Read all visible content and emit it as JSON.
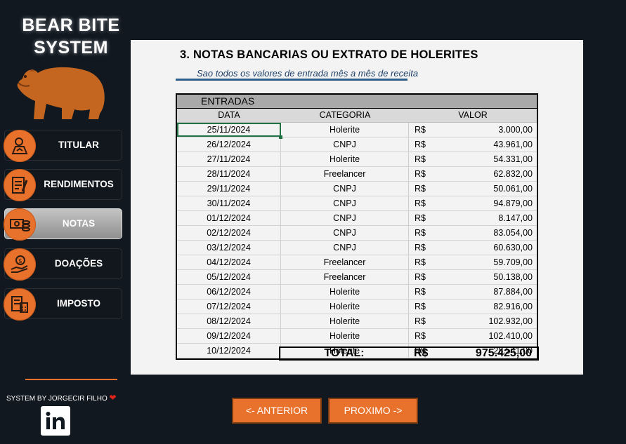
{
  "brand": {
    "line1": "BEAR BITE",
    "line2": "SYSTEM"
  },
  "nav": [
    {
      "label": "TITULAR",
      "icon": "person-document-icon"
    },
    {
      "label": "RENDIMENTOS",
      "icon": "report-pen-icon"
    },
    {
      "label": "NOTAS",
      "icon": "money-coins-icon",
      "active": true
    },
    {
      "label": "DOAÇÕES",
      "icon": "hand-coin-icon"
    },
    {
      "label": "IMPOSTO",
      "icon": "calculator-document-icon"
    }
  ],
  "credits": "SYSTEM BY JORGECIR FILHO",
  "page": {
    "title": "3. NOTAS BANCARIAS OU EXTRATO DE HOLERITES",
    "subtitle": "Sao todos os valores de entrada mês a mês de receita"
  },
  "table": {
    "section": "ENTRADAS",
    "headers": {
      "date": "DATA",
      "category": "CATEGORIA",
      "value": "VALOR"
    },
    "rows": [
      {
        "date": "25/11/2024",
        "category": "Holerite",
        "currency": "R$",
        "value": "3.000,00"
      },
      {
        "date": "26/12/2024",
        "category": "CNPJ",
        "currency": "R$",
        "value": "43.961,00"
      },
      {
        "date": "27/11/2024",
        "category": "Holerite",
        "currency": "R$",
        "value": "54.331,00"
      },
      {
        "date": "28/11/2024",
        "category": "Freelancer",
        "currency": "R$",
        "value": "62.832,00"
      },
      {
        "date": "29/11/2024",
        "category": "CNPJ",
        "currency": "R$",
        "value": "50.061,00"
      },
      {
        "date": "30/11/2024",
        "category": "CNPJ",
        "currency": "R$",
        "value": "94.879,00"
      },
      {
        "date": "01/12/2024",
        "category": "CNPJ",
        "currency": "R$",
        "value": "8.147,00"
      },
      {
        "date": "02/12/2024",
        "category": "CNPJ",
        "currency": "R$",
        "value": "83.054,00"
      },
      {
        "date": "03/12/2024",
        "category": "CNPJ",
        "currency": "R$",
        "value": "60.630,00"
      },
      {
        "date": "04/12/2024",
        "category": "Freelancer",
        "currency": "R$",
        "value": "59.709,00"
      },
      {
        "date": "05/12/2024",
        "category": "Freelancer",
        "currency": "R$",
        "value": "50.138,00"
      },
      {
        "date": "06/12/2024",
        "category": "Holerite",
        "currency": "R$",
        "value": "87.884,00"
      },
      {
        "date": "07/12/2024",
        "category": "Holerite",
        "currency": "R$",
        "value": "82.916,00"
      },
      {
        "date": "08/12/2024",
        "category": "Holerite",
        "currency": "R$",
        "value": "102.932,00"
      },
      {
        "date": "09/12/2024",
        "category": "Holerite",
        "currency": "R$",
        "value": "102.410,00"
      },
      {
        "date": "10/12/2024",
        "category": "Holerite",
        "currency": "R$",
        "value": "28.541,00"
      }
    ],
    "total": {
      "label": "TOTAL:",
      "currency": "R$",
      "value": "975.425,00"
    }
  },
  "buttons": {
    "prev": "<- ANTERIOR",
    "next": "PROXIMO ->"
  },
  "colors": {
    "accent": "#e8712c",
    "background": "#111820",
    "panel": "#f3f3f3"
  }
}
